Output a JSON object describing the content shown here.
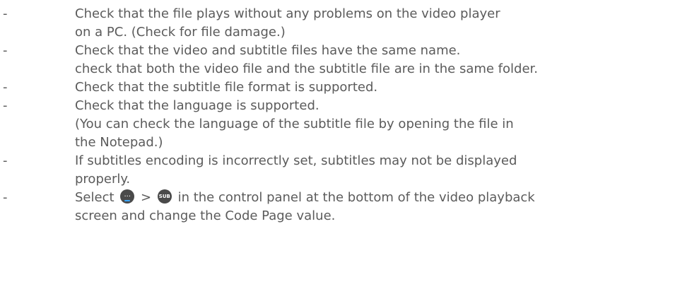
{
  "bullets": [
    {
      "marker": "-",
      "lines": [
        "Check that the file plays without any problems on the video player",
        "on a PC. (Check for file damage.)"
      ]
    },
    {
      "marker": "-",
      "lines": [
        "Check that the video and subtitle files have the same name.",
        "check that both the video file and the subtitle file are in the same folder."
      ]
    },
    {
      "marker": "-",
      "lines": [
        "Check that the subtitle file format is supported."
      ]
    },
    {
      "marker": "-",
      "lines": [
        "Check that the language is supported.",
        "(You can check the language of the subtitle file by opening the file in",
        "the Notepad.)"
      ]
    },
    {
      "marker": "-",
      "lines": [
        "If subtitles encoding is incorrectly set, subtitles may not be displayed",
        "properly."
      ]
    },
    {
      "marker": "-",
      "select_line": {
        "before": "Select",
        "more_icon_label": "...",
        "separator": ">",
        "sub_icon_label": "SUB",
        "after": "in the control panel at the bottom of the video playback"
      },
      "lines": [
        "screen and change the Code Page value."
      ]
    }
  ],
  "icon_colors": {
    "button_bg": "#4a4a4a",
    "button_text": "#ffffff",
    "accent_underline": "#3aa7ff"
  }
}
